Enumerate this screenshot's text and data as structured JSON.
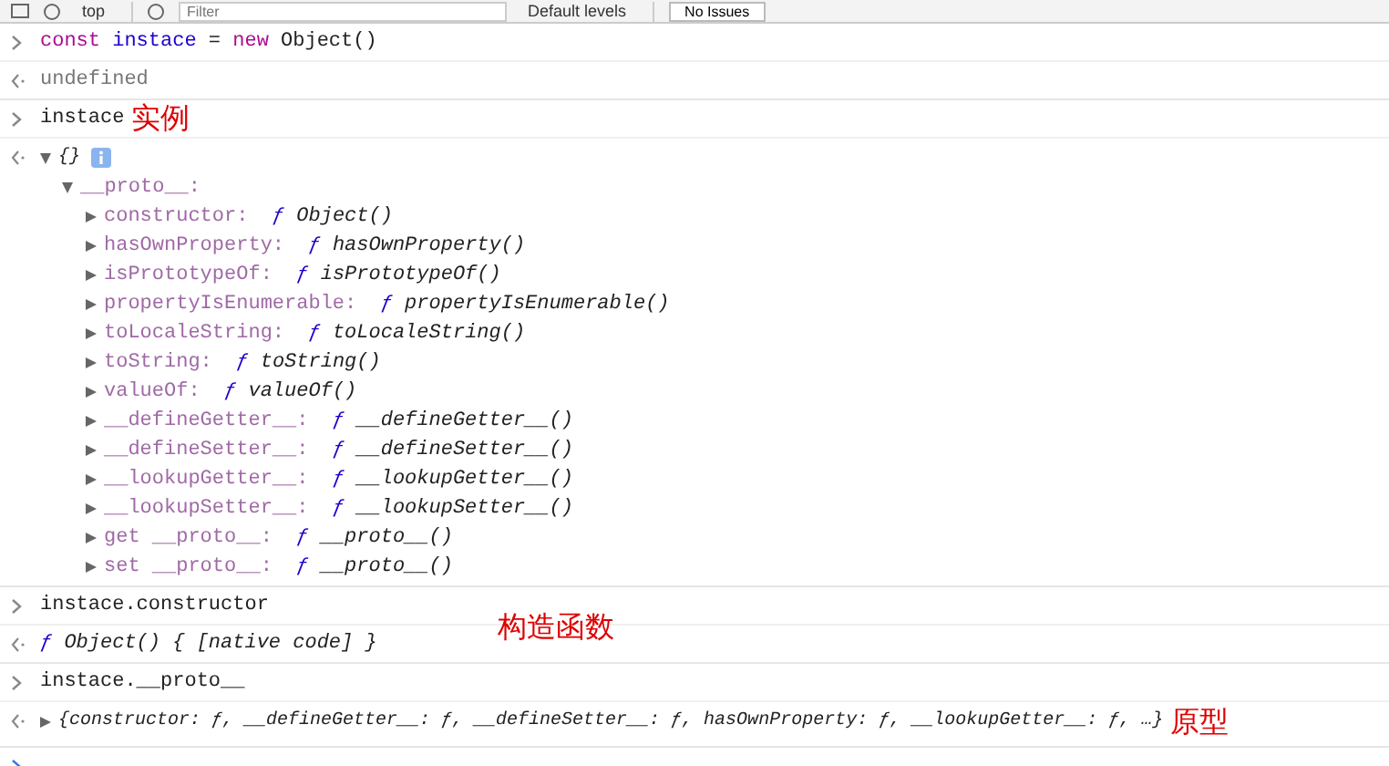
{
  "toolbar": {
    "context": "top",
    "filter_placeholder": "Filter",
    "levels": "Default levels",
    "issues": "No Issues"
  },
  "console": [
    {
      "kind": "input",
      "tokens": [
        {
          "kind": "keyword",
          "text": "const"
        },
        {
          "kind": "variable",
          "text": "instace"
        },
        {
          "kind": "plain",
          "text": "="
        },
        {
          "kind": "keyword",
          "text": "new"
        },
        {
          "kind": "plain",
          "text": "Object()"
        }
      ]
    },
    {
      "kind": "output",
      "text": "undefined",
      "muted": true
    },
    {
      "kind": "input",
      "tokens": [
        {
          "kind": "plain",
          "text": "instace"
        }
      ],
      "annotation": "实例"
    },
    {
      "kind": "object",
      "preview": "{}",
      "expanded": true,
      "info": true,
      "children": [
        {
          "key": "__proto__:",
          "expanded": true,
          "children": [
            {
              "key": "constructor:",
              "sign": "ƒ",
              "value": "Object()",
              "expanded": false
            },
            {
              "key": "hasOwnProperty:",
              "sign": "ƒ",
              "value": "hasOwnProperty()",
              "expanded": false
            },
            {
              "key": "isPrototypeOf:",
              "sign": "ƒ",
              "value": "isPrototypeOf()",
              "expanded": false
            },
            {
              "key": "propertyIsEnumerable:",
              "sign": "ƒ",
              "value": "propertyIsEnumerable()",
              "expanded": false
            },
            {
              "key": "toLocaleString:",
              "sign": "ƒ",
              "value": "toLocaleString()",
              "expanded": false
            },
            {
              "key": "toString:",
              "sign": "ƒ",
              "value": "toString()",
              "expanded": false
            },
            {
              "key": "valueOf:",
              "sign": "ƒ",
              "value": "valueOf()",
              "expanded": false
            },
            {
              "key": "__defineGetter__:",
              "sign": "ƒ",
              "value": "__defineGetter__()",
              "expanded": false
            },
            {
              "key": "__defineSetter__:",
              "sign": "ƒ",
              "value": "__defineSetter__()",
              "expanded": false
            },
            {
              "key": "__lookupGetter__:",
              "sign": "ƒ",
              "value": "__lookupGetter__()",
              "expanded": false
            },
            {
              "key": "__lookupSetter__:",
              "sign": "ƒ",
              "value": "__lookupSetter__()",
              "expanded": false
            },
            {
              "key": "get __proto__:",
              "sign": "ƒ",
              "value": "__proto__()",
              "expanded": false
            },
            {
              "key": "set __proto__:",
              "sign": "ƒ",
              "value": "__proto__()",
              "expanded": false
            }
          ]
        }
      ]
    },
    {
      "kind": "input",
      "tokens": [
        {
          "kind": "plain",
          "text": "instace.constructor"
        }
      ]
    },
    {
      "kind": "output",
      "sign": "ƒ",
      "text": "Object() { [native code] }",
      "muted": false,
      "annotation": "构造函数"
    },
    {
      "kind": "input",
      "tokens": [
        {
          "kind": "plain",
          "text": "instace.__proto__"
        }
      ]
    },
    {
      "kind": "object",
      "preview": "{constructor: ƒ, __defineGetter__: ƒ, __defineSetter__: ƒ, hasOwnProperty: ƒ, __lookupGetter__: ƒ, …}",
      "expanded": false,
      "annotation": "原型"
    },
    {
      "kind": "prompt"
    }
  ]
}
